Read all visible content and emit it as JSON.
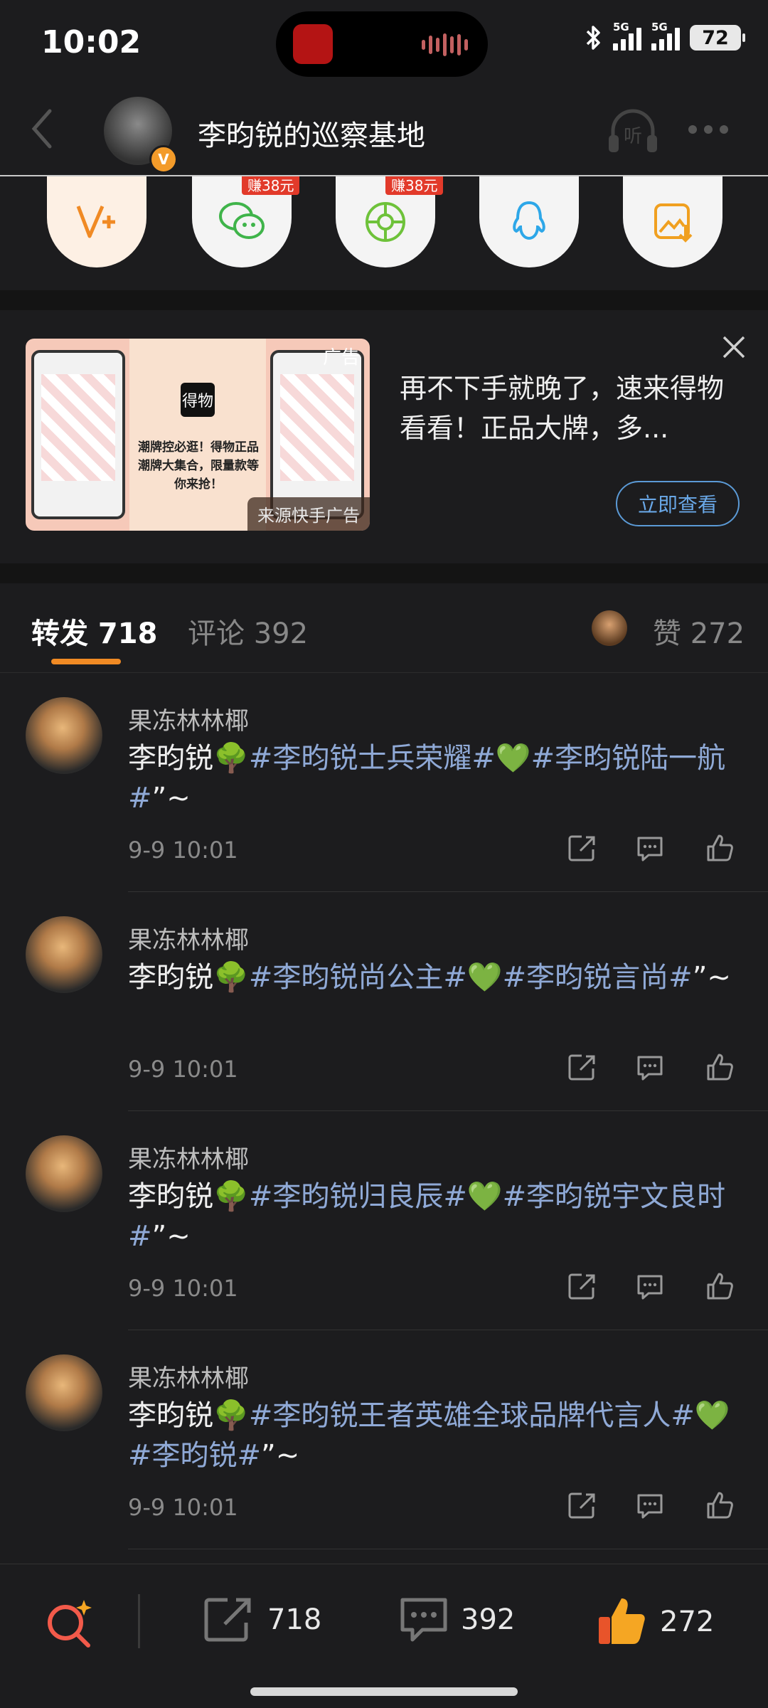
{
  "status_bar": {
    "time": "10:02",
    "network1": "5G",
    "network2": "5G",
    "battery": "72"
  },
  "header": {
    "title": "李昀锐的巡察基地",
    "badge": "V"
  },
  "share": {
    "earn_label_1": "赚38元",
    "earn_label_2": "赚38元"
  },
  "ad": {
    "tag": "广告",
    "source": "来源快手广告",
    "image_logo": "得物",
    "image_text": "潮牌控必逛！得物正品潮牌大集合，限量款等你来抢！",
    "description": "再不下手就晚了，速来得物看看！正品大牌，多...",
    "cta": "立即查看"
  },
  "tabs": {
    "repost_label": "转发 718",
    "comment_label": "评论 392",
    "like_label": "赞 272"
  },
  "reposts": [
    {
      "name": "果冻林林椰",
      "prefix": "李昀锐🌳",
      "topic1": "#李昀锐士兵荣耀#",
      "mid": "💚",
      "topic2": "#李昀锐陆一航#",
      "suffix": "”~",
      "time": "9-9 10:01"
    },
    {
      "name": "果冻林林椰",
      "prefix": "李昀锐🌳",
      "topic1": "#李昀锐尚公主#",
      "mid": "💚",
      "topic2": "#李昀锐言尚#",
      "suffix": "”~",
      "time": "9-9 10:01"
    },
    {
      "name": "果冻林林椰",
      "prefix": "李昀锐🌳",
      "topic1": "#李昀锐归良辰#",
      "mid": "💚",
      "topic2": "#李昀锐宇文良时#",
      "suffix": "”~",
      "time": "9-9 10:01"
    },
    {
      "name": "果冻林林椰",
      "prefix": "李昀锐🌳",
      "topic1": "#李昀锐王者英雄全球品牌代言人#",
      "mid": "💚",
      "topic2": "#李昀锐#",
      "suffix": "”~",
      "time": "9-9 10:01"
    }
  ],
  "bottom_bar": {
    "repost_count": "718",
    "comment_count": "392",
    "like_count": "272"
  },
  "colors": {
    "accent": "#f08a24",
    "topic": "#8fa9d6",
    "background": "#1c1c1e",
    "earn_tag": "#e23a2a"
  }
}
